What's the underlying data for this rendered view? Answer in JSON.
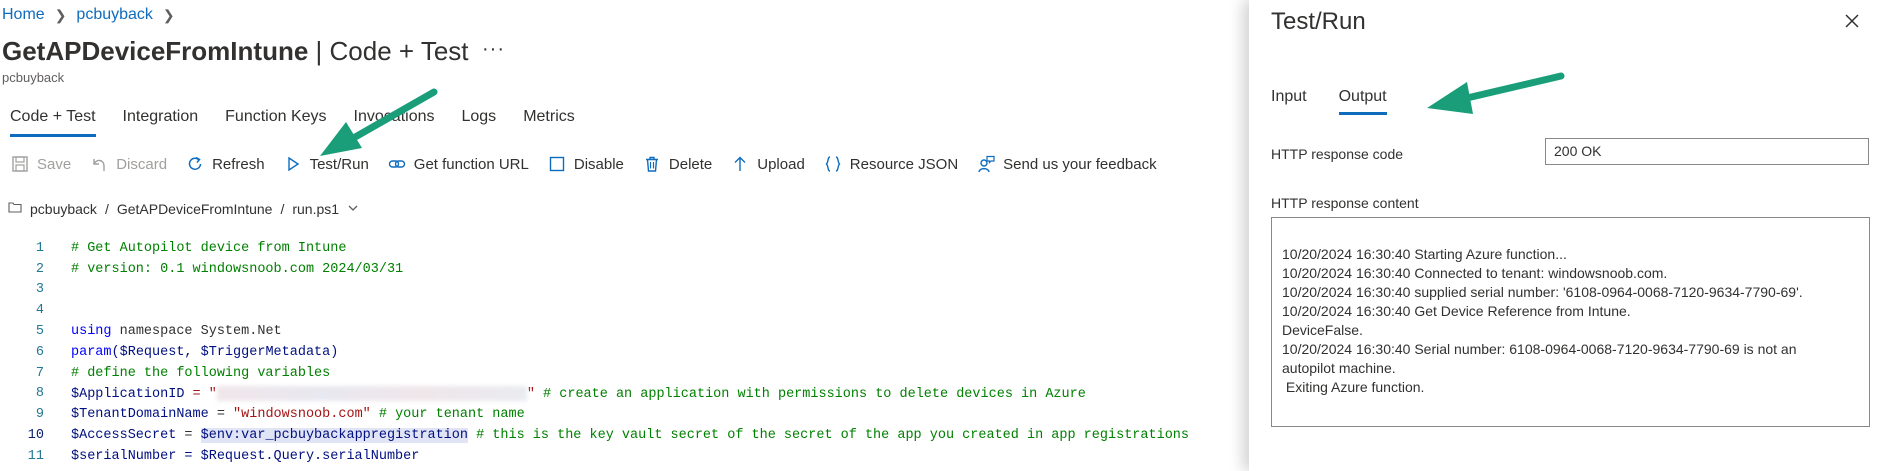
{
  "breadcrumb": {
    "home": "Home",
    "app": "pcbuyback"
  },
  "title": {
    "function_name": "GetAPDeviceFromIntune",
    "separator": " | ",
    "section": "Code + Test",
    "more": "···"
  },
  "subtitle": "pcbuyback",
  "tabs": [
    "Code + Test",
    "Integration",
    "Function Keys",
    "Invocations",
    "Logs",
    "Metrics"
  ],
  "toolbar": {
    "save": "Save",
    "discard": "Discard",
    "refresh": "Refresh",
    "test_run": "Test/Run",
    "get_url": "Get function URL",
    "disable": "Disable",
    "delete": "Delete",
    "upload": "Upload",
    "resource_json": "Resource JSON",
    "feedback": "Send us your feedback"
  },
  "path": {
    "app": "pcbuyback",
    "sep1": "/",
    "function": "GetAPDeviceFromIntune",
    "sep2": "/",
    "file": "run.ps1"
  },
  "code": {
    "line_numbers": [
      "1",
      "2",
      "3",
      "4",
      "5",
      "6",
      "7",
      "8",
      "9",
      "10",
      "11"
    ],
    "l1": "# Get Autopilot device from Intune",
    "l2": "# version: 0.1 windowsnoob.com 2024/03/31",
    "l5_kw": "using",
    "l5_rest": " namespace System.Net",
    "l6_kw": "param",
    "l6_rest": "($Request, $TriggerMetadata)",
    "l7": "# define the following variables",
    "l8_var": "$ApplicationID",
    "l8_eq": " = \"",
    "l8_end": "\"",
    "l8_cm": " # create an application with permissions to delete devices in Azure",
    "l9_var": "$TenantDomainName",
    "l9_eq": " = ",
    "l9_str": "\"windowsnoob.com\"",
    "l9_cm": " # your tenant name",
    "l10_var": "$AccessSecret",
    "l10_eq": " = ",
    "l10_env": "$env:var_pcbuybackappregistration",
    "l10_cm": " # this is the key vault secret of the secret of the app you created in app registrations",
    "l11": "$serialNumber = $Request.Query.serialNumber"
  },
  "panel": {
    "title": "Test/Run",
    "tabs": [
      "Input",
      "Output"
    ],
    "response_code_label": "HTTP response code",
    "response_code_value": "200 OK",
    "response_content_label": "HTTP response content",
    "response_lines": [
      "10/20/2024 16:30:40 Starting Azure function...",
      "10/20/2024 16:30:40 Connected to tenant: windowsnoob.com.",
      "10/20/2024 16:30:40 supplied serial number: '6108-0964-0068-7120-9634-7790-69'.",
      "10/20/2024 16:30:40 Get Device Reference from Intune.",
      "DeviceFalse.",
      "10/20/2024 16:30:40 Serial number: 6108-0964-0068-7120-9634-7790-69 is not an",
      "autopilot machine.",
      " Exiting Azure function."
    ]
  },
  "colors": {
    "accent": "#0f6cbd",
    "arrow": "#1a9e7a"
  }
}
